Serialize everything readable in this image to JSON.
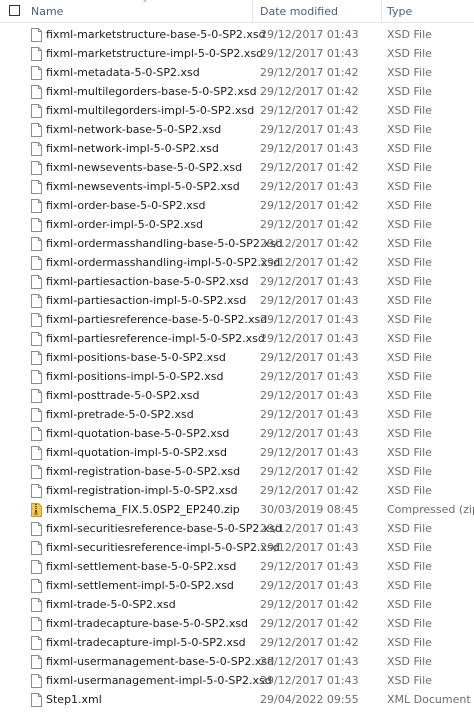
{
  "header": {
    "name_label": "Name",
    "date_label": "Date modified",
    "type_label": "Type"
  },
  "files": [
    {
      "name": "fixml-marketstructure-base-5-0-SP2.xsd",
      "date": "29/12/2017 01:43",
      "type": "XSD File",
      "icon": "file-icon"
    },
    {
      "name": "fixml-marketstructure-impl-5-0-SP2.xsd",
      "date": "29/12/2017 01:43",
      "type": "XSD File",
      "icon": "file-icon"
    },
    {
      "name": "fixml-metadata-5-0-SP2.xsd",
      "date": "29/12/2017 01:42",
      "type": "XSD File",
      "icon": "file-icon"
    },
    {
      "name": "fixml-multilegorders-base-5-0-SP2.xsd",
      "date": "29/12/2017 01:42",
      "type": "XSD File",
      "icon": "file-icon"
    },
    {
      "name": "fixml-multilegorders-impl-5-0-SP2.xsd",
      "date": "29/12/2017 01:42",
      "type": "XSD File",
      "icon": "file-icon"
    },
    {
      "name": "fixml-network-base-5-0-SP2.xsd",
      "date": "29/12/2017 01:43",
      "type": "XSD File",
      "icon": "file-icon"
    },
    {
      "name": "fixml-network-impl-5-0-SP2.xsd",
      "date": "29/12/2017 01:43",
      "type": "XSD File",
      "icon": "file-icon"
    },
    {
      "name": "fixml-newsevents-base-5-0-SP2.xsd",
      "date": "29/12/2017 01:42",
      "type": "XSD File",
      "icon": "file-icon"
    },
    {
      "name": "fixml-newsevents-impl-5-0-SP2.xsd",
      "date": "29/12/2017 01:43",
      "type": "XSD File",
      "icon": "file-icon"
    },
    {
      "name": "fixml-order-base-5-0-SP2.xsd",
      "date": "29/12/2017 01:42",
      "type": "XSD File",
      "icon": "file-icon"
    },
    {
      "name": "fixml-order-impl-5-0-SP2.xsd",
      "date": "29/12/2017 01:42",
      "type": "XSD File",
      "icon": "file-icon"
    },
    {
      "name": "fixml-ordermasshandling-base-5-0-SP2.xsd",
      "date": "29/12/2017 01:42",
      "type": "XSD File",
      "icon": "file-icon"
    },
    {
      "name": "fixml-ordermasshandling-impl-5-0-SP2.xsd",
      "date": "29/12/2017 01:42",
      "type": "XSD File",
      "icon": "file-icon"
    },
    {
      "name": "fixml-partiesaction-base-5-0-SP2.xsd",
      "date": "29/12/2017 01:43",
      "type": "XSD File",
      "icon": "file-icon"
    },
    {
      "name": "fixml-partiesaction-impl-5-0-SP2.xsd",
      "date": "29/12/2017 01:43",
      "type": "XSD File",
      "icon": "file-icon"
    },
    {
      "name": "fixml-partiesreference-base-5-0-SP2.xsd",
      "date": "29/12/2017 01:43",
      "type": "XSD File",
      "icon": "file-icon"
    },
    {
      "name": "fixml-partiesreference-impl-5-0-SP2.xsd",
      "date": "29/12/2017 01:43",
      "type": "XSD File",
      "icon": "file-icon"
    },
    {
      "name": "fixml-positions-base-5-0-SP2.xsd",
      "date": "29/12/2017 01:43",
      "type": "XSD File",
      "icon": "file-icon"
    },
    {
      "name": "fixml-positions-impl-5-0-SP2.xsd",
      "date": "29/12/2017 01:43",
      "type": "XSD File",
      "icon": "file-icon"
    },
    {
      "name": "fixml-posttrade-5-0-SP2.xsd",
      "date": "29/12/2017 01:43",
      "type": "XSD File",
      "icon": "file-icon"
    },
    {
      "name": "fixml-pretrade-5-0-SP2.xsd",
      "date": "29/12/2017 01:43",
      "type": "XSD File",
      "icon": "file-icon"
    },
    {
      "name": "fixml-quotation-base-5-0-SP2.xsd",
      "date": "29/12/2017 01:43",
      "type": "XSD File",
      "icon": "file-icon"
    },
    {
      "name": "fixml-quotation-impl-5-0-SP2.xsd",
      "date": "29/12/2017 01:43",
      "type": "XSD File",
      "icon": "file-icon"
    },
    {
      "name": "fixml-registration-base-5-0-SP2.xsd",
      "date": "29/12/2017 01:42",
      "type": "XSD File",
      "icon": "file-icon"
    },
    {
      "name": "fixml-registration-impl-5-0-SP2.xsd",
      "date": "29/12/2017 01:42",
      "type": "XSD File",
      "icon": "file-icon"
    },
    {
      "name": "fixmlschema_FIX.5.0SP2_EP240.zip",
      "date": "30/03/2019 08:45",
      "type": "Compressed (zipp...",
      "icon": "zip-folder-icon"
    },
    {
      "name": "fixml-securitiesreference-base-5-0-SP2.xsd",
      "date": "29/12/2017 01:43",
      "type": "XSD File",
      "icon": "file-icon"
    },
    {
      "name": "fixml-securitiesreference-impl-5-0-SP2.xsd",
      "date": "29/12/2017 01:43",
      "type": "XSD File",
      "icon": "file-icon"
    },
    {
      "name": "fixml-settlement-base-5-0-SP2.xsd",
      "date": "29/12/2017 01:43",
      "type": "XSD File",
      "icon": "file-icon"
    },
    {
      "name": "fixml-settlement-impl-5-0-SP2.xsd",
      "date": "29/12/2017 01:43",
      "type": "XSD File",
      "icon": "file-icon"
    },
    {
      "name": "fixml-trade-5-0-SP2.xsd",
      "date": "29/12/2017 01:42",
      "type": "XSD File",
      "icon": "file-icon"
    },
    {
      "name": "fixml-tradecapture-base-5-0-SP2.xsd",
      "date": "29/12/2017 01:42",
      "type": "XSD File",
      "icon": "file-icon"
    },
    {
      "name": "fixml-tradecapture-impl-5-0-SP2.xsd",
      "date": "29/12/2017 01:42",
      "type": "XSD File",
      "icon": "file-icon"
    },
    {
      "name": "fixml-usermanagement-base-5-0-SP2.xsd",
      "date": "29/12/2017 01:43",
      "type": "XSD File",
      "icon": "file-icon"
    },
    {
      "name": "fixml-usermanagement-impl-5-0-SP2.xsd",
      "date": "29/12/2017 01:43",
      "type": "XSD File",
      "icon": "file-icon"
    },
    {
      "name": "Step1.xml",
      "date": "29/04/2022 09:55",
      "type": "XML Document",
      "icon": "file-icon"
    }
  ]
}
